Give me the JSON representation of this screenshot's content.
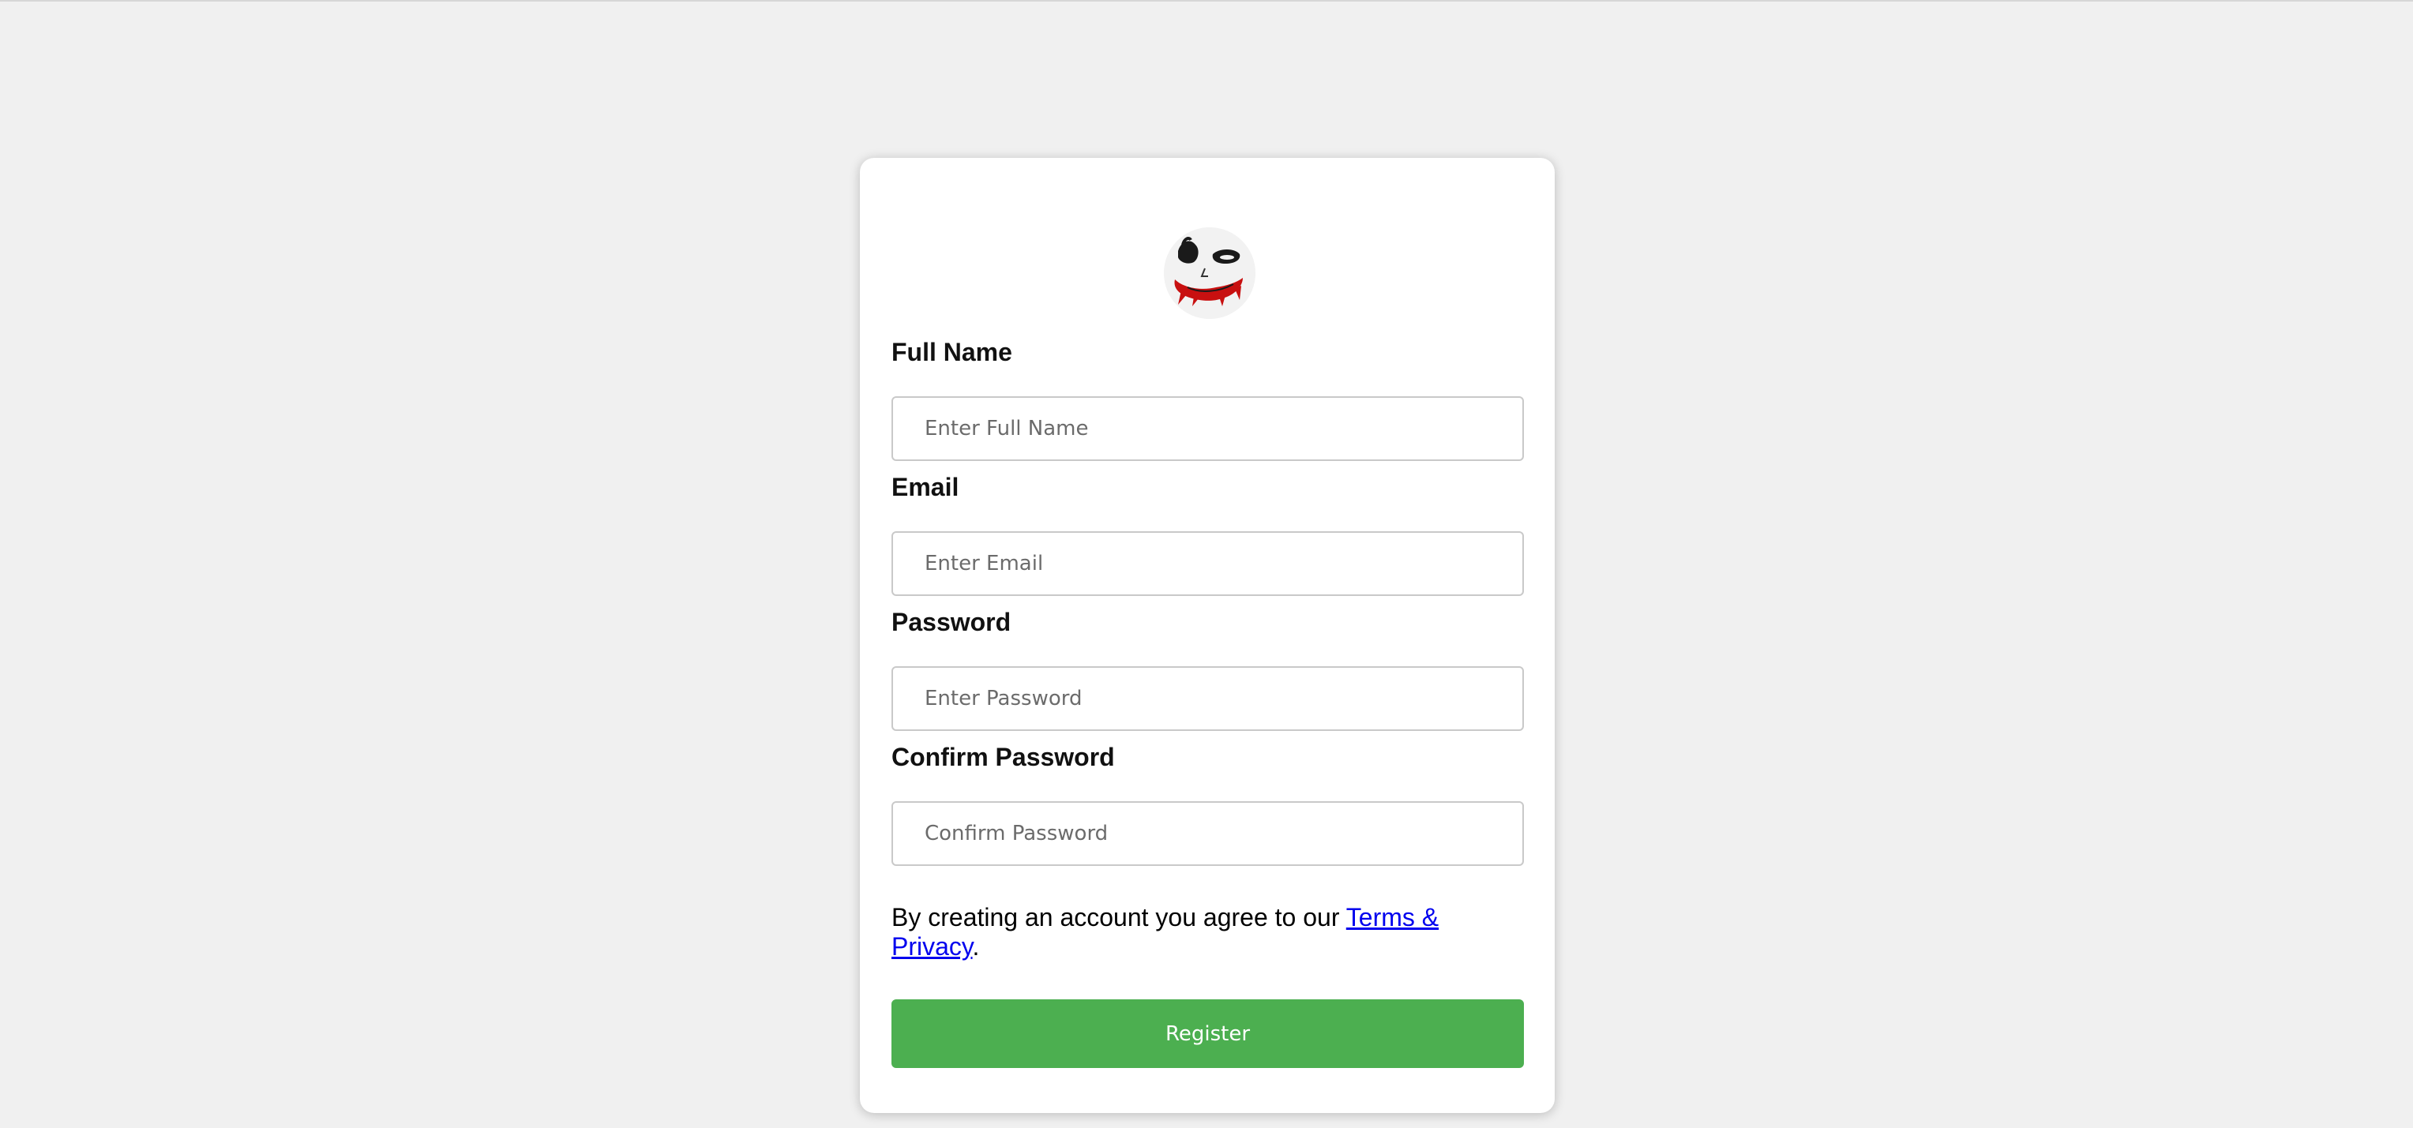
{
  "form": {
    "full_name": {
      "label": "Full Name",
      "placeholder": "Enter Full Name",
      "value": ""
    },
    "email": {
      "label": "Email",
      "placeholder": "Enter Email",
      "value": ""
    },
    "password": {
      "label": "Password",
      "placeholder": "Enter Password",
      "value": ""
    },
    "confirm_password": {
      "label": "Confirm Password",
      "placeholder": "Confirm Password",
      "value": ""
    }
  },
  "terms": {
    "text_before": "By creating an account you agree to our ",
    "link_label": "Terms & Privacy",
    "text_after": "."
  },
  "register_button": {
    "label": "Register",
    "color": "#4caf50"
  },
  "avatar": {
    "icon": "joker-face-icon"
  },
  "colors": {
    "background": "#f0f0f0",
    "link": "#0000ee"
  }
}
